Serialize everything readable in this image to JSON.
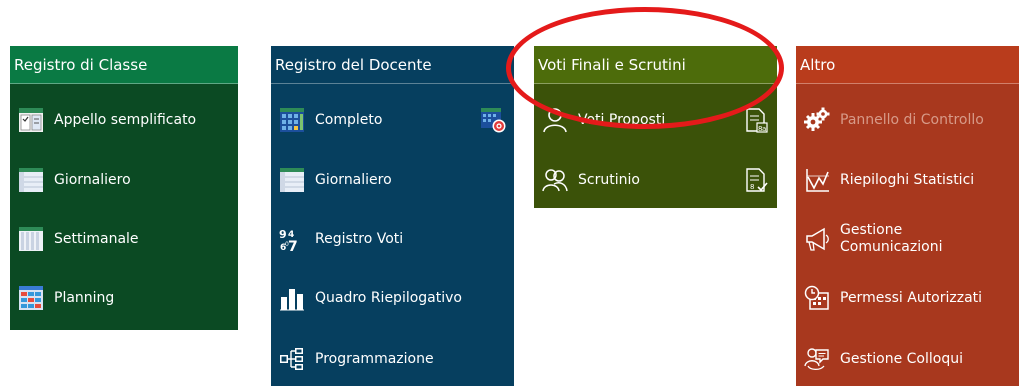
{
  "panels": {
    "classe": {
      "title": "Registro di Classe",
      "items": [
        {
          "label": "Appello semplificato",
          "icon": "attendance-sheet-icon"
        },
        {
          "label": "Giornaliero",
          "icon": "daily-sheet-icon"
        },
        {
          "label": "Settimanale",
          "icon": "weekly-sheet-icon"
        },
        {
          "label": "Planning",
          "icon": "planning-grid-icon"
        }
      ]
    },
    "docente": {
      "title": "Registro del Docente",
      "items": [
        {
          "label": "Completo",
          "icon": "full-register-icon",
          "side_icon": "register-target-icon"
        },
        {
          "label": "Giornaliero",
          "icon": "daily-sheet-icon"
        },
        {
          "label": "Registro Voti",
          "icon": "grades-numbers-icon"
        },
        {
          "label": "Quadro Riepilogativo",
          "icon": "bar-chart-icon"
        },
        {
          "label": "Programmazione",
          "icon": "hierarchy-icon"
        }
      ]
    },
    "voti": {
      "title": "Voti Finali e Scrutini",
      "items": [
        {
          "label": "Voti Proposti",
          "icon": "user-icon",
          "side_icon": "document-grade-icon"
        },
        {
          "label": "Scrutinio",
          "icon": "group-icon",
          "side_icon": "document-check-icon"
        }
      ]
    },
    "altro": {
      "title": "Altro",
      "items": [
        {
          "label": "Pannello di Controllo",
          "icon": "gears-icon",
          "disabled": true
        },
        {
          "label": "Riepiloghi Statistici",
          "icon": "line-chart-icon"
        },
        {
          "label_line1": "Gestione",
          "label_line2": "Comunicazioni",
          "icon": "megaphone-icon"
        },
        {
          "label": "Permessi Autorizzati",
          "icon": "permits-icon"
        },
        {
          "label": "Gestione Colloqui",
          "icon": "chat-people-icon"
        }
      ]
    }
  },
  "colors": {
    "classe_header": "#0a7a44",
    "classe_body": "#0b4a23",
    "docente": "#063f5f",
    "voti_header": "#4d6c0b",
    "voti_body": "#3b5209",
    "altro_header": "#b93c1c",
    "altro_body": "#a8381e",
    "annotation": "#e41a1a"
  }
}
